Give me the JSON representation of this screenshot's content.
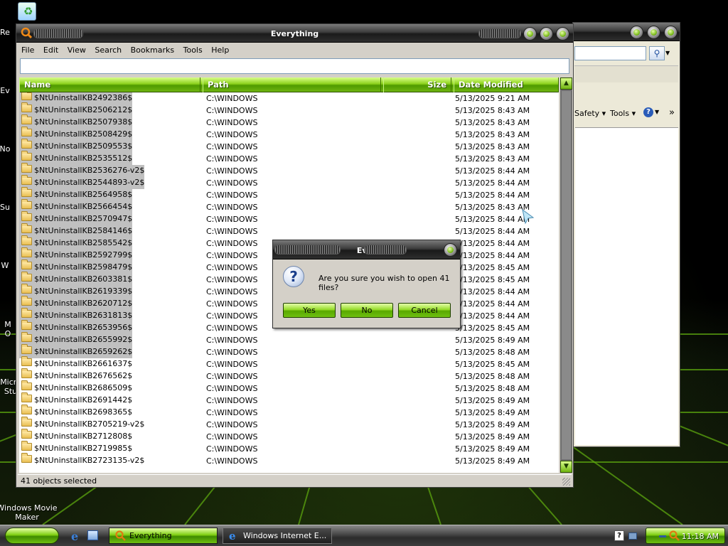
{
  "desktop": {
    "icons": [
      {
        "label": "Windows Movie\nMaker"
      }
    ],
    "left_edge_fragments": [
      "Re",
      "Ev",
      "No",
      "Su",
      "W",
      "M\nO",
      "Micro\nStu"
    ]
  },
  "everything_window": {
    "title": "Everything",
    "menu": [
      "File",
      "Edit",
      "View",
      "Search",
      "Bookmarks",
      "Tools",
      "Help"
    ],
    "search_value": "",
    "columns": [
      "Name",
      "Path",
      "Size",
      "Date Modified"
    ],
    "rows": [
      {
        "name": "$NtUninstallKB2492386$",
        "path": "C:\\WINDOWS",
        "date": "5/13/2025 9:21 AM",
        "selected": true
      },
      {
        "name": "$NtUninstallKB2506212$",
        "path": "C:\\WINDOWS",
        "date": "5/13/2025 8:43 AM",
        "selected": true
      },
      {
        "name": "$NtUninstallKB2507938$",
        "path": "C:\\WINDOWS",
        "date": "5/13/2025 8:43 AM",
        "selected": true
      },
      {
        "name": "$NtUninstallKB2508429$",
        "path": "C:\\WINDOWS",
        "date": "5/13/2025 8:43 AM",
        "selected": true
      },
      {
        "name": "$NtUninstallKB2509553$",
        "path": "C:\\WINDOWS",
        "date": "5/13/2025 8:43 AM",
        "selected": true
      },
      {
        "name": "$NtUninstallKB2535512$",
        "path": "C:\\WINDOWS",
        "date": "5/13/2025 8:43 AM",
        "selected": true
      },
      {
        "name": "$NtUninstallKB2536276-v2$",
        "path": "C:\\WINDOWS",
        "date": "5/13/2025 8:44 AM",
        "selected": true
      },
      {
        "name": "$NtUninstallKB2544893-v2$",
        "path": "C:\\WINDOWS",
        "date": "5/13/2025 8:44 AM",
        "selected": true
      },
      {
        "name": "$NtUninstallKB2564958$",
        "path": "C:\\WINDOWS",
        "date": "5/13/2025 8:44 AM",
        "selected": true
      },
      {
        "name": "$NtUninstallKB2566454$",
        "path": "C:\\WINDOWS",
        "date": "5/13/2025 8:43 AM",
        "selected": true
      },
      {
        "name": "$NtUninstallKB2570947$",
        "path": "C:\\WINDOWS",
        "date": "5/13/2025 8:44 AM",
        "selected": true
      },
      {
        "name": "$NtUninstallKB2584146$",
        "path": "C:\\WINDOWS",
        "date": "5/13/2025 8:44 AM",
        "selected": true
      },
      {
        "name": "$NtUninstallKB2585542$",
        "path": "C:\\WINDOWS",
        "date": "5/13/2025 8:44 AM",
        "selected": true
      },
      {
        "name": "$NtUninstallKB2592799$",
        "path": "C:\\WINDOWS",
        "date": "5/13/2025 8:44 AM",
        "selected": true
      },
      {
        "name": "$NtUninstallKB2598479$",
        "path": "C:\\WINDOWS",
        "date": "5/13/2025 8:45 AM",
        "selected": true
      },
      {
        "name": "$NtUninstallKB2603381$",
        "path": "C:\\WINDOWS",
        "date": "5/13/2025 8:45 AM",
        "selected": true
      },
      {
        "name": "$NtUninstallKB2619339$",
        "path": "C:\\WINDOWS",
        "date": "5/13/2025 8:44 AM",
        "selected": true
      },
      {
        "name": "$NtUninstallKB2620712$",
        "path": "C:\\WINDOWS",
        "date": "5/13/2025 8:44 AM",
        "selected": true
      },
      {
        "name": "$NtUninstallKB2631813$",
        "path": "C:\\WINDOWS",
        "date": "5/13/2025 8:44 AM",
        "selected": true
      },
      {
        "name": "$NtUninstallKB2653956$",
        "path": "C:\\WINDOWS",
        "date": "5/13/2025 8:45 AM",
        "selected": true
      },
      {
        "name": "$NtUninstallKB2655992$",
        "path": "C:\\WINDOWS",
        "date": "5/13/2025 8:49 AM",
        "selected": true
      },
      {
        "name": "$NtUninstallKB2659262$",
        "path": "C:\\WINDOWS",
        "date": "5/13/2025 8:48 AM",
        "selected": true
      },
      {
        "name": "$NtUninstallKB2661637$",
        "path": "C:\\WINDOWS",
        "date": "5/13/2025 8:45 AM",
        "selected": false
      },
      {
        "name": "$NtUninstallKB2676562$",
        "path": "C:\\WINDOWS",
        "date": "5/13/2025 8:48 AM",
        "selected": false
      },
      {
        "name": "$NtUninstallKB2686509$",
        "path": "C:\\WINDOWS",
        "date": "5/13/2025 8:48 AM",
        "selected": false
      },
      {
        "name": "$NtUninstallKB2691442$",
        "path": "C:\\WINDOWS",
        "date": "5/13/2025 8:49 AM",
        "selected": false
      },
      {
        "name": "$NtUninstallKB2698365$",
        "path": "C:\\WINDOWS",
        "date": "5/13/2025 8:49 AM",
        "selected": false
      },
      {
        "name": "$NtUninstallKB2705219-v2$",
        "path": "C:\\WINDOWS",
        "date": "5/13/2025 8:49 AM",
        "selected": false
      },
      {
        "name": "$NtUninstallKB2712808$",
        "path": "C:\\WINDOWS",
        "date": "5/13/2025 8:49 AM",
        "selected": false
      },
      {
        "name": "$NtUninstallKB2719985$",
        "path": "C:\\WINDOWS",
        "date": "5/13/2025 8:49 AM",
        "selected": false
      },
      {
        "name": "$NtUninstallKB2723135-v2$",
        "path": "C:\\WINDOWS",
        "date": "5/13/2025 8:49 AM",
        "selected": false
      }
    ],
    "status": "41 objects selected"
  },
  "ie_window": {
    "toolbar": [
      "Safety ▾",
      "Tools ▾"
    ],
    "chevron": "»"
  },
  "dialog": {
    "title": "Everything",
    "message": "Are you sure you wish to open 41 files?",
    "buttons": {
      "yes": "Yes",
      "no": "No",
      "cancel": "Cancel"
    }
  },
  "taskbar": {
    "tasks": [
      {
        "label": "Everything",
        "icon": "search-icon",
        "active": true
      },
      {
        "label": "Windows Internet E...",
        "icon": "ie-icon",
        "active": false
      }
    ],
    "clock": "11:18 AM"
  },
  "colors": {
    "accent_green": "#7fcf12",
    "dark_green": "#3f8a00"
  }
}
